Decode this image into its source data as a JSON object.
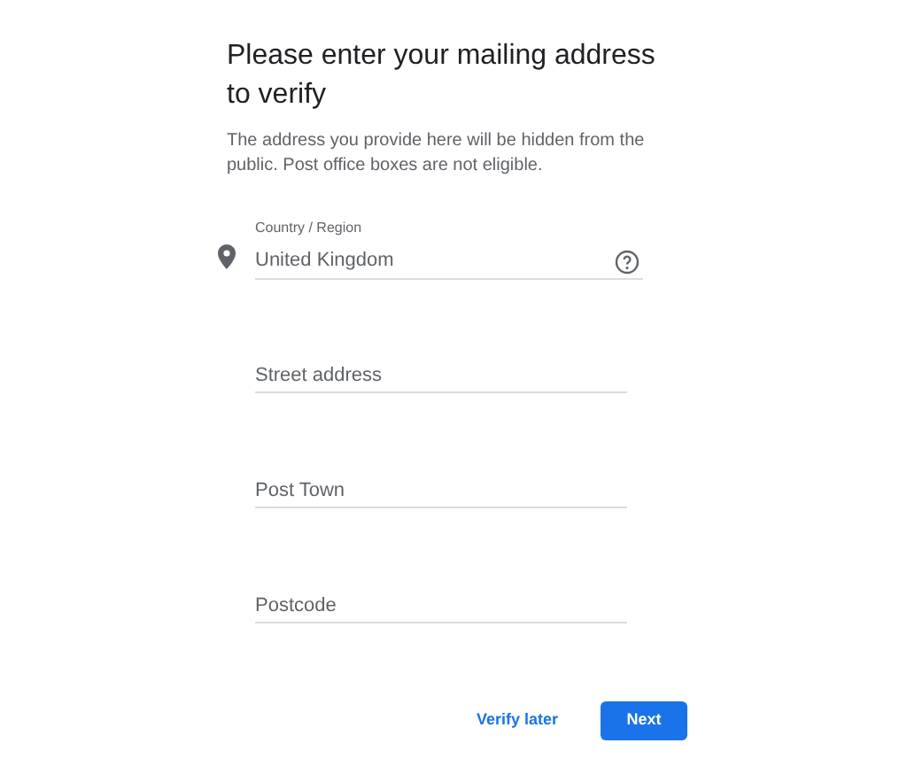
{
  "title": "Please enter your mailing address to verify",
  "description": "The address you provide here will be hidden from the public. Post office boxes are not eligible.",
  "fields": [
    {
      "kind": "select",
      "label": "Country / Region",
      "value": "United Kingdom"
    },
    {
      "kind": "text",
      "placeholder": "Street address"
    },
    {
      "kind": "text",
      "placeholder": "Post Town"
    },
    {
      "kind": "text",
      "placeholder": "Postcode"
    }
  ],
  "buttons": [
    {
      "kind": "text",
      "label": "Verify later"
    },
    {
      "kind": "primary",
      "label": "Next"
    }
  ]
}
